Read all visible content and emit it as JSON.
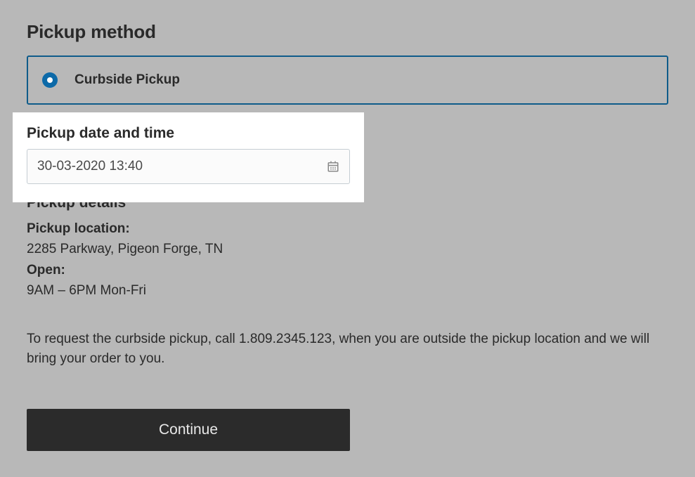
{
  "pickup_method": {
    "title": "Pickup method",
    "option_label": "Curbside Pickup"
  },
  "datetime": {
    "title": "Pickup date and time",
    "value": "30-03-2020 13:40"
  },
  "details": {
    "title": "Pickup details",
    "location_label": "Pickup location:",
    "location_value": "2285 Parkway, Pigeon Forge, TN",
    "open_label": "Open:",
    "open_value": "9AM – 6PM Mon-Fri",
    "instructions": "To request the curbside pickup, call 1.809.2345.123, when you are outside the pickup location and we will bring your order to you."
  },
  "actions": {
    "continue_label": "Continue"
  }
}
